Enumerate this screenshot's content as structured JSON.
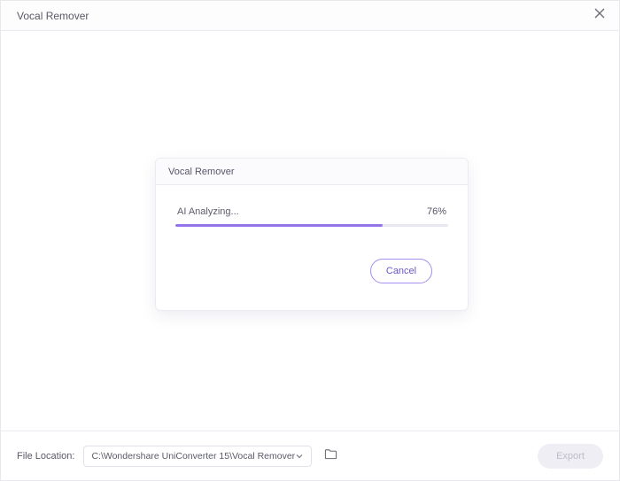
{
  "window": {
    "title": "Vocal Remover"
  },
  "dialog": {
    "title": "Vocal Remover",
    "status_text": "AI Analyzing...",
    "percent_value": 76,
    "percent_label": "76%",
    "cancel_label": "Cancel"
  },
  "footer": {
    "location_label": "File Location:",
    "path": "C:\\Wondershare UniConverter 15\\Vocal Remover",
    "export_label": "Export"
  },
  "colors": {
    "accent": "#9374ea"
  }
}
